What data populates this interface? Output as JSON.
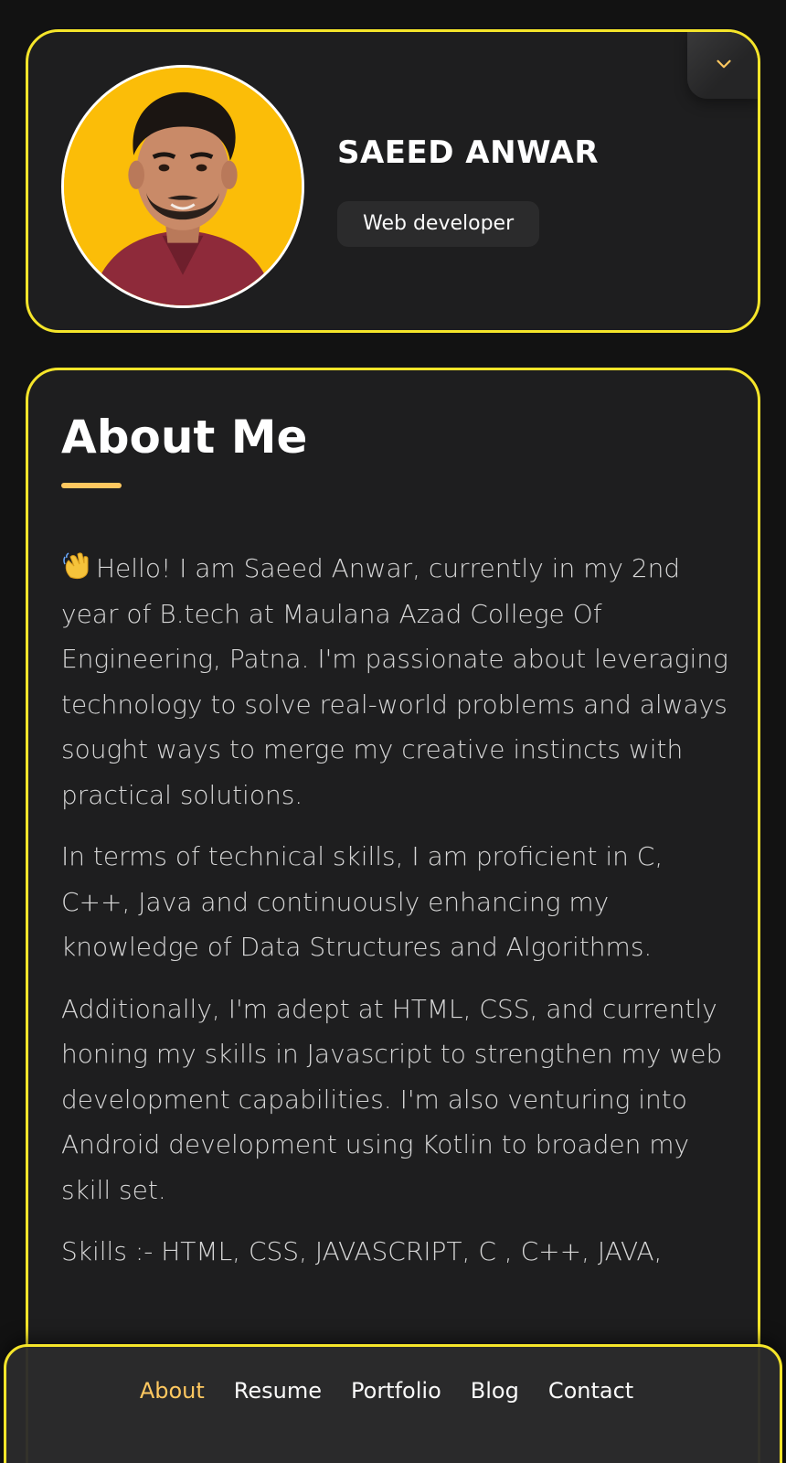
{
  "profile": {
    "name": "SAEED ANWAR",
    "title": "Web developer",
    "avatar_icon": "avatar-photo",
    "toggle_icon": "chevron-down-icon"
  },
  "about": {
    "heading": "About Me",
    "wave_icon": "waving-hand-icon",
    "paragraphs": [
      "Hello! I am Saeed Anwar, currently in my 2nd year of B.tech at Maulana Azad College Of Engineering, Patna. I'm passionate about leveraging technology to solve real-world problems and always sought ways to merge my creative instincts with practical solutions.",
      "In terms of technical skills, I am proficient in C, C++, Java and continuously enhancing my knowledge of Data Structures and Algorithms.",
      "Additionally, I'm adept at HTML, CSS, and currently honing my skills in Javascript to strengthen my web development capabilities. I'm also venturing into Android development using Kotlin to broaden my skill set.",
      "Skills :- HTML, CSS, JAVASCRIPT, C , C++, JAVA,"
    ]
  },
  "navbar": {
    "items": [
      {
        "label": "About",
        "active": true
      },
      {
        "label": "Resume",
        "active": false
      },
      {
        "label": "Portfolio",
        "active": false
      },
      {
        "label": "Blog",
        "active": false
      },
      {
        "label": "Contact",
        "active": false
      }
    ]
  },
  "colors": {
    "accent_border": "#f5e52a",
    "accent_text": "#ffc860",
    "card_bg": "#1e1e1f",
    "page_bg": "#121212"
  }
}
